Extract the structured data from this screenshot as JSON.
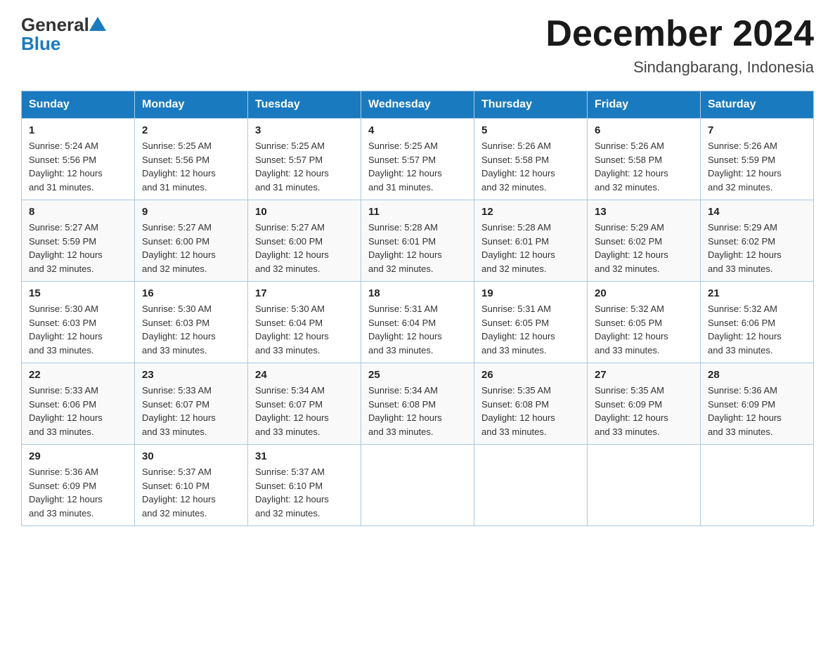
{
  "logo": {
    "text_general": "General",
    "text_blue": "Blue"
  },
  "title": {
    "month_year": "December 2024",
    "location": "Sindangbarang, Indonesia"
  },
  "days_header": [
    "Sunday",
    "Monday",
    "Tuesday",
    "Wednesday",
    "Thursday",
    "Friday",
    "Saturday"
  ],
  "weeks": [
    [
      {
        "day": "1",
        "sunrise": "5:24 AM",
        "sunset": "5:56 PM",
        "daylight": "12 hours and 31 minutes."
      },
      {
        "day": "2",
        "sunrise": "5:25 AM",
        "sunset": "5:56 PM",
        "daylight": "12 hours and 31 minutes."
      },
      {
        "day": "3",
        "sunrise": "5:25 AM",
        "sunset": "5:57 PM",
        "daylight": "12 hours and 31 minutes."
      },
      {
        "day": "4",
        "sunrise": "5:25 AM",
        "sunset": "5:57 PM",
        "daylight": "12 hours and 31 minutes."
      },
      {
        "day": "5",
        "sunrise": "5:26 AM",
        "sunset": "5:58 PM",
        "daylight": "12 hours and 32 minutes."
      },
      {
        "day": "6",
        "sunrise": "5:26 AM",
        "sunset": "5:58 PM",
        "daylight": "12 hours and 32 minutes."
      },
      {
        "day": "7",
        "sunrise": "5:26 AM",
        "sunset": "5:59 PM",
        "daylight": "12 hours and 32 minutes."
      }
    ],
    [
      {
        "day": "8",
        "sunrise": "5:27 AM",
        "sunset": "5:59 PM",
        "daylight": "12 hours and 32 minutes."
      },
      {
        "day": "9",
        "sunrise": "5:27 AM",
        "sunset": "6:00 PM",
        "daylight": "12 hours and 32 minutes."
      },
      {
        "day": "10",
        "sunrise": "5:27 AM",
        "sunset": "6:00 PM",
        "daylight": "12 hours and 32 minutes."
      },
      {
        "day": "11",
        "sunrise": "5:28 AM",
        "sunset": "6:01 PM",
        "daylight": "12 hours and 32 minutes."
      },
      {
        "day": "12",
        "sunrise": "5:28 AM",
        "sunset": "6:01 PM",
        "daylight": "12 hours and 32 minutes."
      },
      {
        "day": "13",
        "sunrise": "5:29 AM",
        "sunset": "6:02 PM",
        "daylight": "12 hours and 32 minutes."
      },
      {
        "day": "14",
        "sunrise": "5:29 AM",
        "sunset": "6:02 PM",
        "daylight": "12 hours and 33 minutes."
      }
    ],
    [
      {
        "day": "15",
        "sunrise": "5:30 AM",
        "sunset": "6:03 PM",
        "daylight": "12 hours and 33 minutes."
      },
      {
        "day": "16",
        "sunrise": "5:30 AM",
        "sunset": "6:03 PM",
        "daylight": "12 hours and 33 minutes."
      },
      {
        "day": "17",
        "sunrise": "5:30 AM",
        "sunset": "6:04 PM",
        "daylight": "12 hours and 33 minutes."
      },
      {
        "day": "18",
        "sunrise": "5:31 AM",
        "sunset": "6:04 PM",
        "daylight": "12 hours and 33 minutes."
      },
      {
        "day": "19",
        "sunrise": "5:31 AM",
        "sunset": "6:05 PM",
        "daylight": "12 hours and 33 minutes."
      },
      {
        "day": "20",
        "sunrise": "5:32 AM",
        "sunset": "6:05 PM",
        "daylight": "12 hours and 33 minutes."
      },
      {
        "day": "21",
        "sunrise": "5:32 AM",
        "sunset": "6:06 PM",
        "daylight": "12 hours and 33 minutes."
      }
    ],
    [
      {
        "day": "22",
        "sunrise": "5:33 AM",
        "sunset": "6:06 PM",
        "daylight": "12 hours and 33 minutes."
      },
      {
        "day": "23",
        "sunrise": "5:33 AM",
        "sunset": "6:07 PM",
        "daylight": "12 hours and 33 minutes."
      },
      {
        "day": "24",
        "sunrise": "5:34 AM",
        "sunset": "6:07 PM",
        "daylight": "12 hours and 33 minutes."
      },
      {
        "day": "25",
        "sunrise": "5:34 AM",
        "sunset": "6:08 PM",
        "daylight": "12 hours and 33 minutes."
      },
      {
        "day": "26",
        "sunrise": "5:35 AM",
        "sunset": "6:08 PM",
        "daylight": "12 hours and 33 minutes."
      },
      {
        "day": "27",
        "sunrise": "5:35 AM",
        "sunset": "6:09 PM",
        "daylight": "12 hours and 33 minutes."
      },
      {
        "day": "28",
        "sunrise": "5:36 AM",
        "sunset": "6:09 PM",
        "daylight": "12 hours and 33 minutes."
      }
    ],
    [
      {
        "day": "29",
        "sunrise": "5:36 AM",
        "sunset": "6:09 PM",
        "daylight": "12 hours and 33 minutes."
      },
      {
        "day": "30",
        "sunrise": "5:37 AM",
        "sunset": "6:10 PM",
        "daylight": "12 hours and 32 minutes."
      },
      {
        "day": "31",
        "sunrise": "5:37 AM",
        "sunset": "6:10 PM",
        "daylight": "12 hours and 32 minutes."
      },
      null,
      null,
      null,
      null
    ]
  ],
  "labels": {
    "sunrise": "Sunrise:",
    "sunset": "Sunset:",
    "daylight": "Daylight:"
  }
}
